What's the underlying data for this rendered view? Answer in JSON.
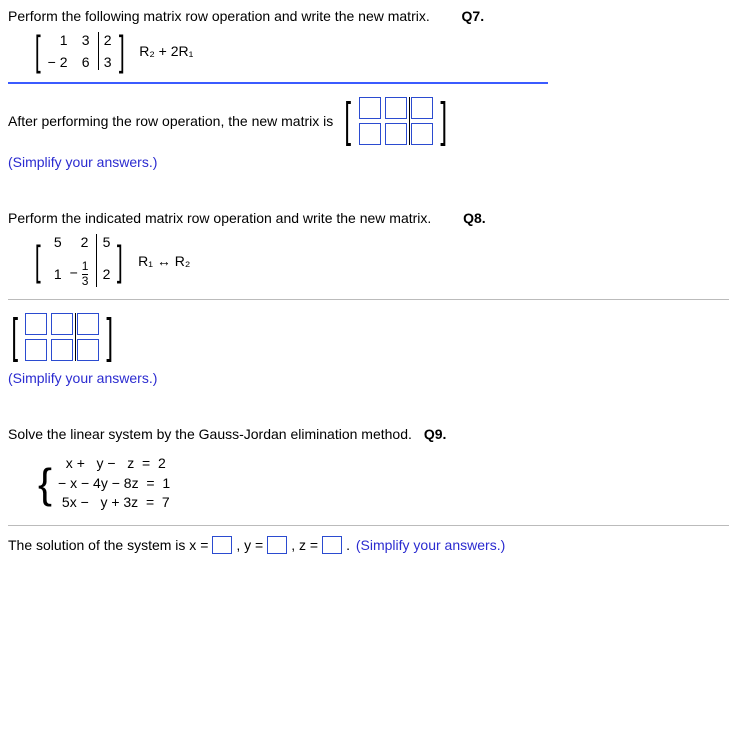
{
  "q7": {
    "prompt": "Perform the following matrix row operation and write the new matrix.",
    "label": "Q7.",
    "matrix": {
      "r1c1": "1",
      "r1c2": "3",
      "r1c3": "2",
      "r2c1": "− 2",
      "r2c2": "6",
      "r2c3": "3"
    },
    "row_op": "R₂ + 2R₁",
    "result_prefix": "After performing the row operation, the new matrix is",
    "simplify": "(Simplify your answers.)"
  },
  "q8": {
    "prompt": "Perform the indicated matrix row operation and write the new matrix.",
    "label": "Q8.",
    "matrix": {
      "r1c1": "5",
      "r1c2": "2",
      "r1c3": "5",
      "r2c1": "1",
      "r2c2_neg": "−",
      "r2c2_num": "1",
      "r2c2_den": "3",
      "r2c3": "2"
    },
    "row_op": "R₁ ↔ R₂",
    "simplify": "(Simplify your answers.)"
  },
  "q9": {
    "prompt": "Solve the linear system by the Gauss-Jordan elimination method.",
    "label": "Q9.",
    "eq1": "  x +   y −   z  =  2",
    "eq2": "− x − 4y − 8z  =  1",
    "eq3": " 5x −   y + 3z  =  7",
    "sol_prefix": "The solution of the system is x =",
    "sol_y": ", y =",
    "sol_z": ", z =",
    "sol_suffix": ". (Simplify your answers.)",
    "simplify_inline": "(Simplify your answers.)"
  }
}
